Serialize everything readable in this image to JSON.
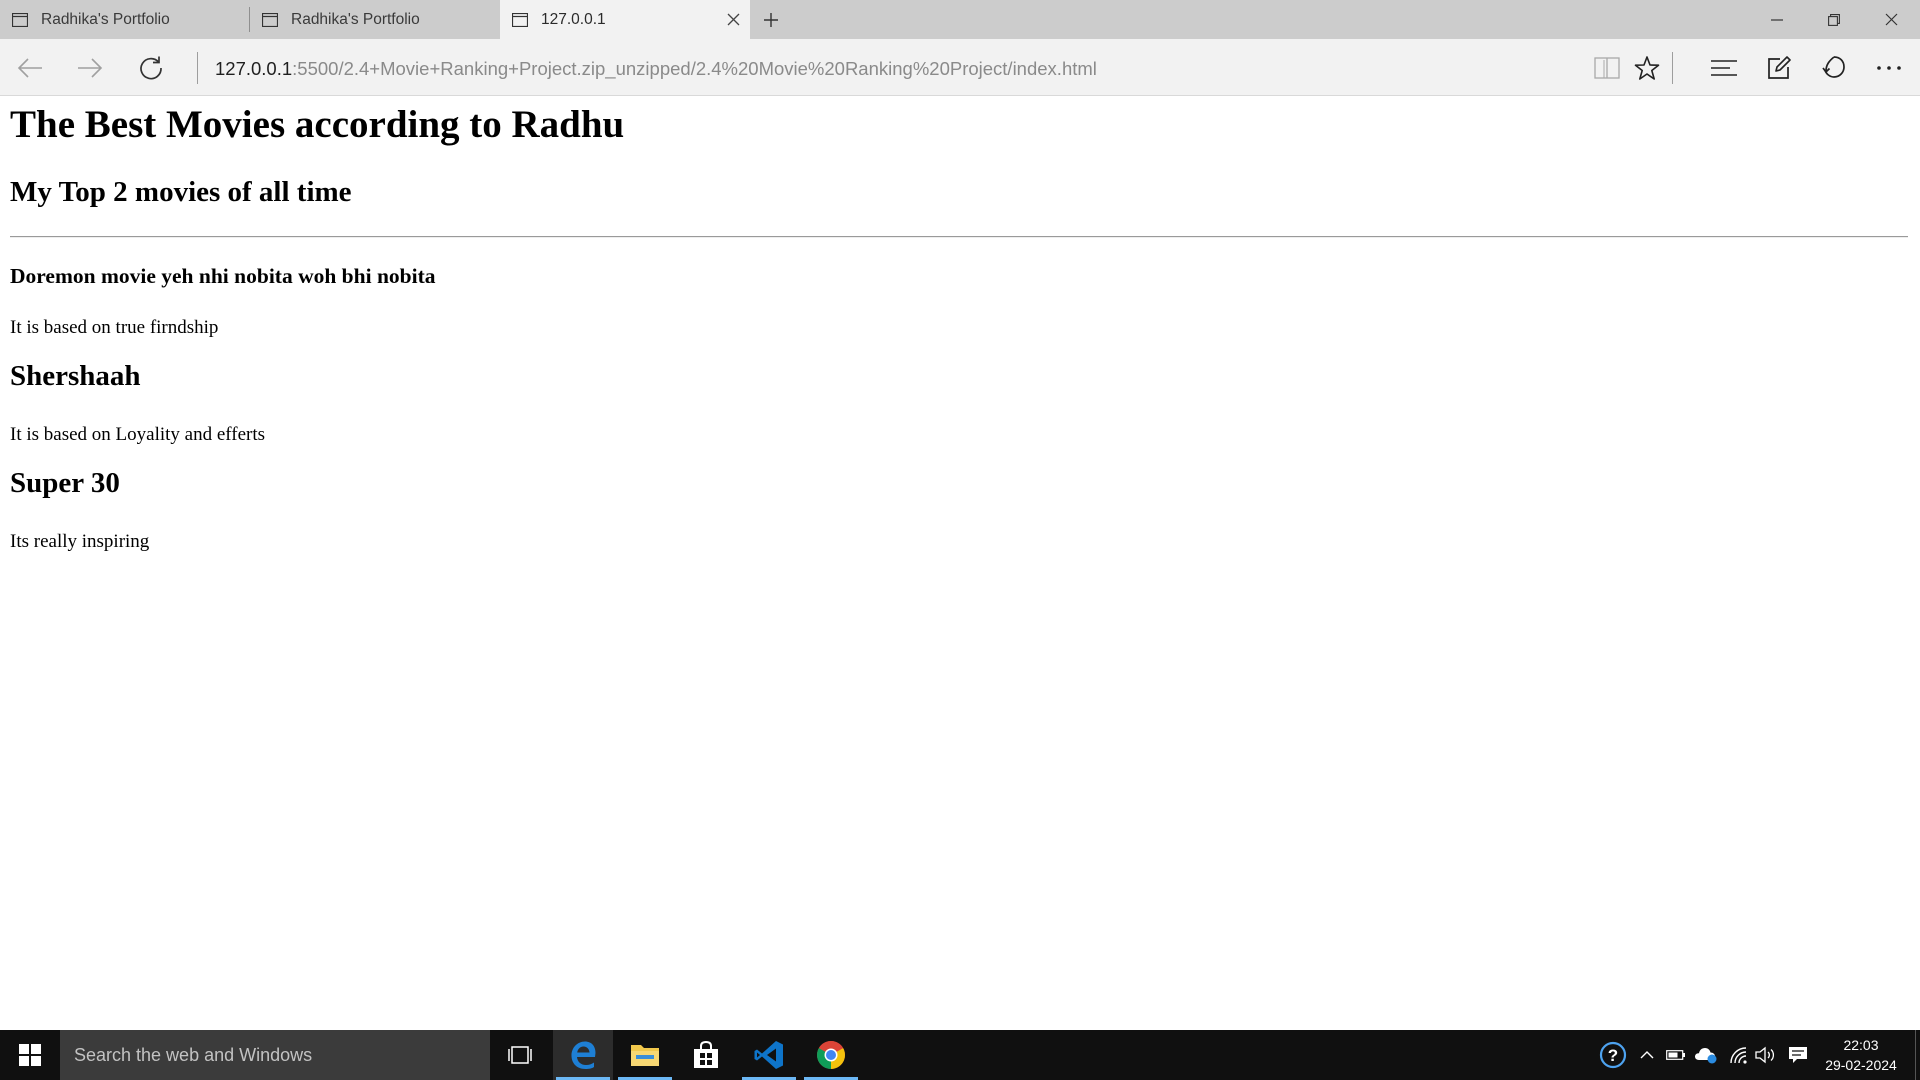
{
  "browser": {
    "tabs": [
      {
        "title": "Radhika's Portfolio",
        "active": false
      },
      {
        "title": "Radhika's Portfolio",
        "active": false
      },
      {
        "title": "127.0.0.1",
        "active": true
      }
    ],
    "address": {
      "host": "127.0.0.1",
      "path": ":5500/2.4+Movie+Ranking+Project.zip_unzipped/2.4%20Movie%20Ranking%20Project/index.html"
    }
  },
  "page": {
    "heading": "The Best Movies according to Radhu",
    "subheading": "My Top 2 movies of all time",
    "movies": [
      {
        "title": "Doremon movie yeh nhi nobita woh bhi nobita",
        "desc": "It is based on true firndship"
      },
      {
        "title": "Shershaah",
        "desc": "It is based on Loyality and efferts"
      },
      {
        "title": "Super 30",
        "desc": "Its really inspiring"
      }
    ]
  },
  "taskbar": {
    "search_placeholder": "Search the web and Windows",
    "apps": [
      "task-view",
      "edge",
      "file-explorer",
      "store",
      "vscode",
      "chrome"
    ],
    "clock": {
      "time": "22:03",
      "date": "29-02-2024"
    }
  },
  "colors": {
    "tab_strip": "#cccccc",
    "active_tab": "#f2f2f2",
    "taskbar": "#101010",
    "edge_blue": "#1e7fd4",
    "vscode_blue": "#0e74c9"
  }
}
